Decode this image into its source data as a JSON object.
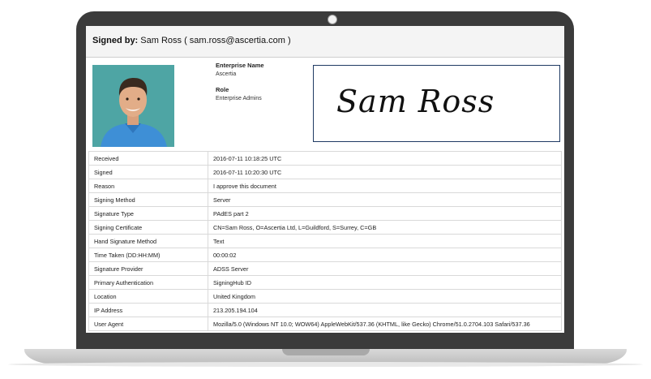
{
  "header": {
    "label": "Signed by:",
    "signer": "Sam Ross ( sam.ross@ascertia.com )"
  },
  "profile": {
    "enterprise_name_label": "Enterprise Name",
    "enterprise_name": "Ascertia",
    "role_label": "Role",
    "role": "Enterprise Admins"
  },
  "signature": {
    "text": "Sam Ross"
  },
  "details": [
    {
      "key": "Received",
      "value": "2016-07-11 10:18:25 UTC"
    },
    {
      "key": "Signed",
      "value": "2016-07-11 10:20:30 UTC"
    },
    {
      "key": "Reason",
      "value": "I approve this document"
    },
    {
      "key": "Signing Method",
      "value": "Server"
    },
    {
      "key": "Signature Type",
      "value": "PAdES part 2"
    },
    {
      "key": "Signing Certificate",
      "value": "CN=Sam Ross, O=Ascertia Ltd, L=Guildford, S=Surrey, C=GB"
    },
    {
      "key": "Hand Signature Method",
      "value": "Text"
    },
    {
      "key": "Time Taken (DD:HH:MM)",
      "value": "00:00:02"
    },
    {
      "key": "Signature Provider",
      "value": "ADSS Server"
    },
    {
      "key": "Primary Authentication",
      "value": "SigningHub ID"
    },
    {
      "key": "Location",
      "value": "United Kingdom"
    },
    {
      "key": "IP Address",
      "value": "213.205.194.104"
    },
    {
      "key": "User Agent",
      "value": "Mozilla/5.0 (Windows NT 10.0; WOW64) AppleWebKit/537.36 (KHTML, like Gecko) Chrome/51.0.2704.103 Safari/537.36"
    }
  ],
  "colors": {
    "laptop_body": "#3b3b3b",
    "header_bg": "#f4f4f4",
    "signature_border": "#1f3a63",
    "photo_bg": "#4ea5a4",
    "shirt": "#3e8fd6"
  }
}
